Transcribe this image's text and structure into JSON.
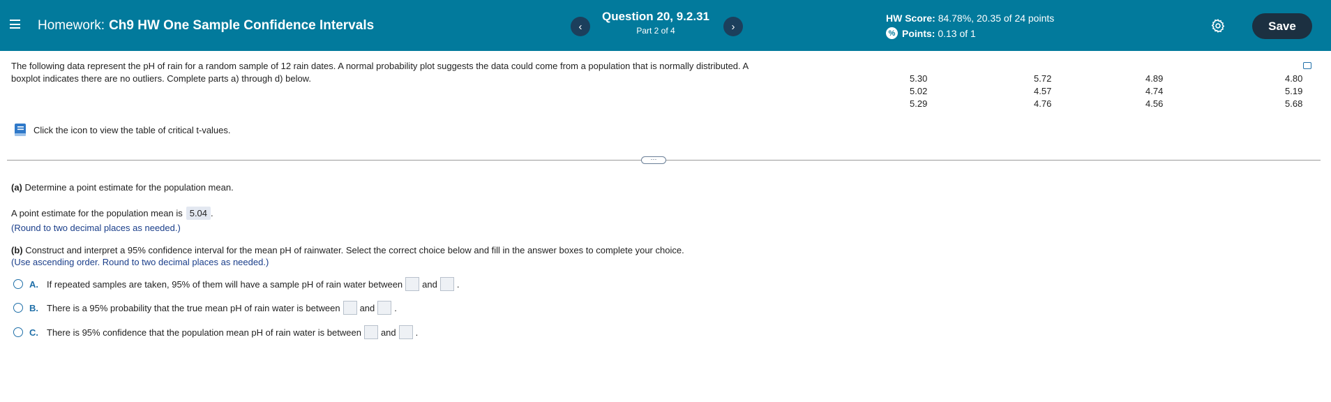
{
  "header": {
    "title_prefix": "Homework:",
    "title_name": "Ch9 HW One Sample Confidence Intervals",
    "question_title": "Question 20, 9.2.31",
    "question_part": "Part 2 of 4",
    "hw_score_label": "HW Score:",
    "hw_score_value": "84.78%, 20.35 of 24 points",
    "points_label": "Points:",
    "points_value": "0.13 of 1",
    "save_label": "Save",
    "prev_glyph": "‹",
    "next_glyph": "›"
  },
  "problem": {
    "text": "The following data represent the pH of rain for a random sample of 12 rain dates. A normal probability plot suggests the data could come from a population that is normally distributed. A boxplot indicates there are no outliers. Complete parts a) through d) below.",
    "data_columns": [
      [
        "5.30",
        "5.02",
        "5.29"
      ],
      [
        "5.72",
        "4.57",
        "4.76"
      ],
      [
        "4.89",
        "4.74",
        "4.56"
      ],
      [
        "4.80",
        "5.19",
        "5.68"
      ]
    ],
    "tvalues_text": "Click the icon to view the table of critical t-values."
  },
  "part_a": {
    "label": "(a)",
    "question": "Determine a point estimate for the population mean.",
    "answer_prefix": "A point estimate for the population mean is",
    "answer_value": "5.04",
    "answer_suffix": ".",
    "hint": "(Round to two decimal places as needed.)"
  },
  "part_b": {
    "label": "(b)",
    "question": "Construct and interpret a 95% confidence interval for the mean pH of rainwater. Select the correct choice below and fill in the answer boxes to complete your choice.",
    "hint": "(Use ascending order. Round to two decimal places as needed.)",
    "choices": [
      {
        "letter": "A.",
        "text": "If repeated samples are taken, 95% of them will have a sample pH of rain water between",
        "and": "and",
        "end": "."
      },
      {
        "letter": "B.",
        "text": "There is a 95% probability that the true mean pH of rain water is between",
        "and": "and",
        "end": "."
      },
      {
        "letter": "C.",
        "text": "There is 95% confidence that the population mean pH of rain water is between",
        "and": "and",
        "end": "."
      }
    ]
  },
  "divider_handle": "···",
  "colors": {
    "header_bg": "#027a9c",
    "save_bg": "#1c3041",
    "link_blue": "#1f6fa8",
    "hint_blue": "#1a3e8a"
  }
}
